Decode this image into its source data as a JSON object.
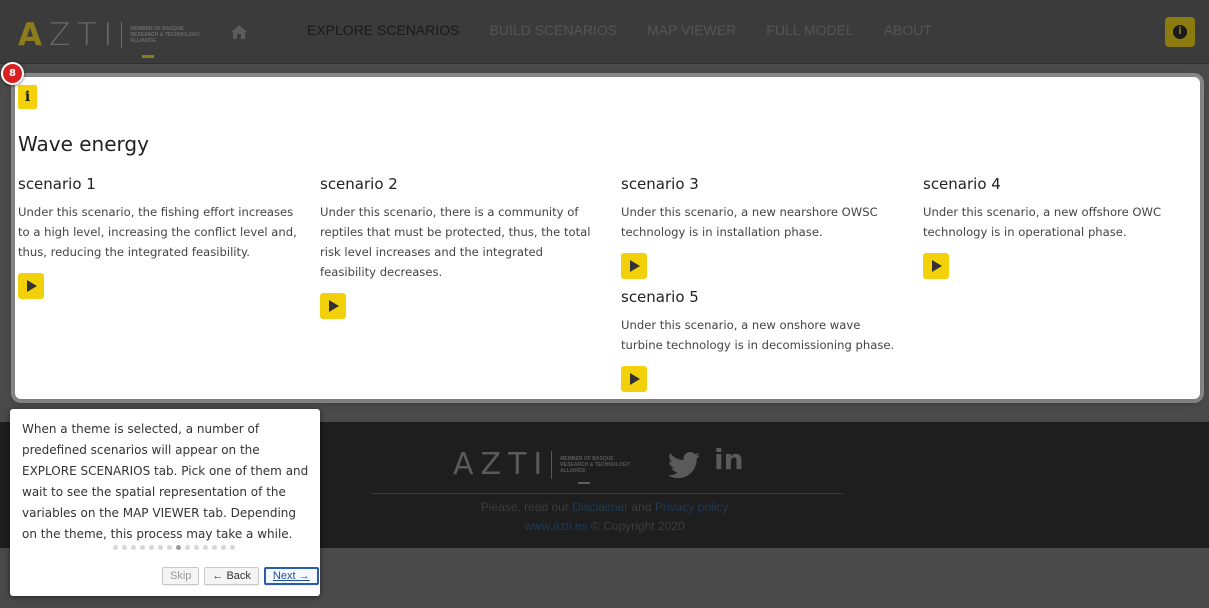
{
  "navbar": {
    "logo_letters": [
      "A",
      "Z",
      "T",
      "I"
    ],
    "logo_tagline": "MEMBER OF BASQUE RESEARCH & TECHNOLOGY ALLIANCE",
    "home_icon": "home-icon",
    "links": [
      {
        "label": "EXPLORE SCENARIOS",
        "active": true
      },
      {
        "label": "BUILD SCENARIOS",
        "active": false
      },
      {
        "label": "MAP VIEWER",
        "active": false
      },
      {
        "label": "FULL MODEL",
        "active": false
      },
      {
        "label": "ABOUT",
        "active": false
      }
    ],
    "info_button_glyph": "i"
  },
  "panel": {
    "info_glyph": "i",
    "step_badge": "8",
    "title": "Wave energy",
    "scenarios": [
      {
        "title": "scenario 1",
        "description": "Under this scenario, the fishing effort increases to a high level, increasing the conflict level and, thus, reducing the integrated feasibility."
      },
      {
        "title": "scenario 2",
        "description": "Under this scenario, there is a community of reptiles that must be protected, thus, the total risk level increases and the integrated feasibility decreases."
      },
      {
        "title": "scenario 3",
        "description": "Under this scenario, a new nearshore OWSC technology is in installation phase."
      },
      {
        "title": "scenario 4",
        "description": "Under this scenario, a new offshore OWC technology is in operational phase."
      },
      {
        "title": "scenario 5",
        "description": "Under this scenario, a new onshore wave turbine technology is in decomissioning phase."
      }
    ]
  },
  "footer": {
    "logo_letters": "AZTI",
    "logo_tagline": "MEMBER OF BASQUE RESEARCH & TECHNOLOGY ALLIANCE",
    "social_icons": [
      "twitter-icon",
      "linkedin-icon"
    ],
    "linkedin_text": "in",
    "line1_prefix": "Please, read our ",
    "disclaimer_link": "Disclaimer",
    "line1_mid": " and ",
    "privacy_link": "Privacy policy",
    "site_link": "www.azti.es",
    "copyright": " © Copyright 2020"
  },
  "tooltip": {
    "text": "When a theme is selected, a number of predefined scenarios will appear on the EXPLORE SCENARIOS tab. Pick one of them and wait to see the spatial representation of the variables on the MAP VIEWER tab. Depending on the theme, this process may take a while.",
    "total_steps": 14,
    "current_step": 8,
    "skip_label": "Skip",
    "back_label": "← Back",
    "next_label": "Next →"
  },
  "colors": {
    "accent_yellow": "#f3d10a",
    "badge_red": "#d92020",
    "footer_bg": "#1e1e1e",
    "overlay_gray": "#4a4a4a"
  }
}
